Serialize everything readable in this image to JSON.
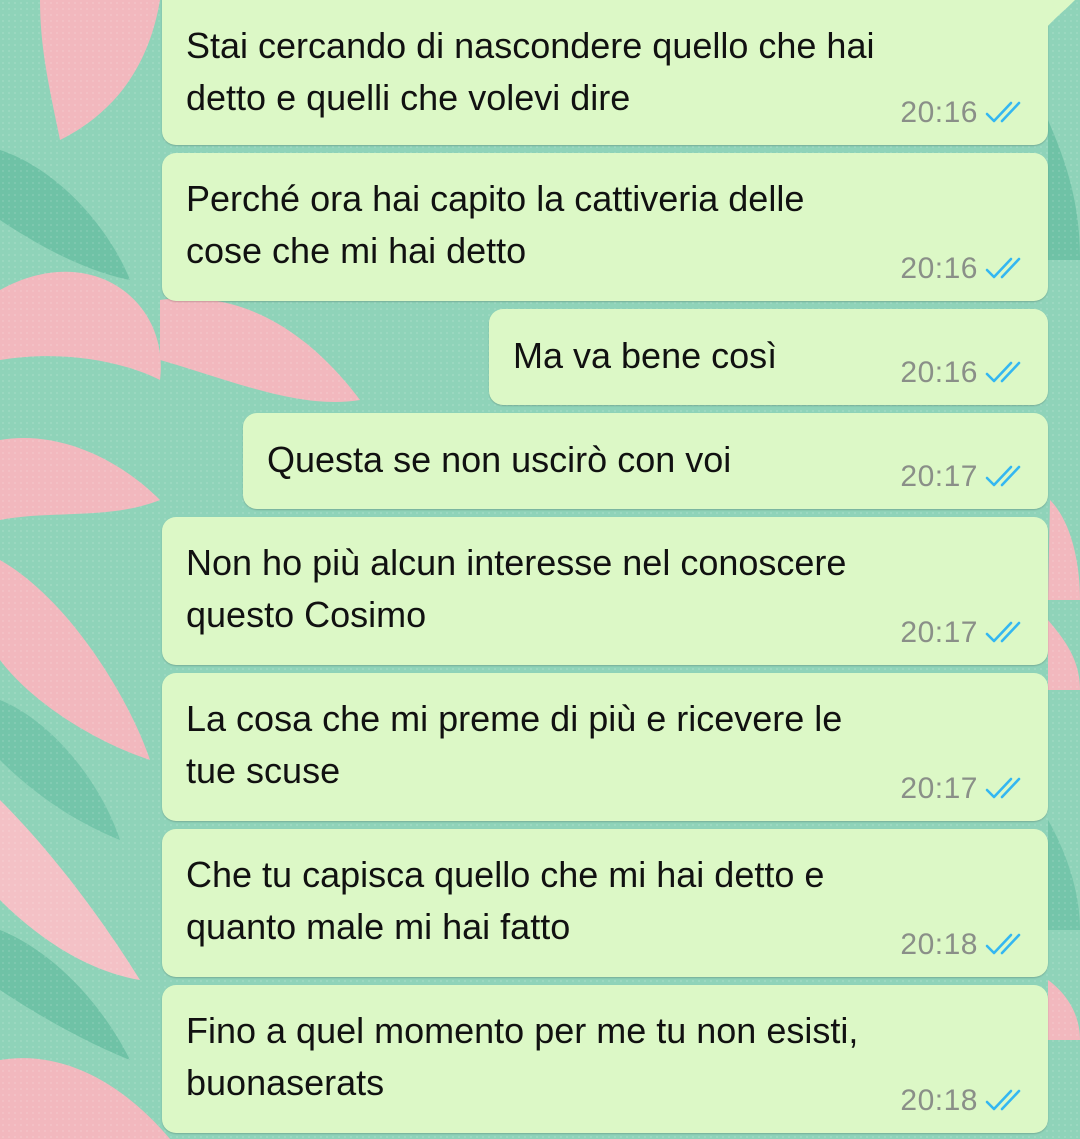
{
  "colors": {
    "bubble_outgoing": "#dcf8c6",
    "read_tick": "#34b7f1",
    "timestamp": "#8a8f88",
    "wallpaper_green": "#8fd3b9",
    "wallpaper_pink": "#f2b8be"
  },
  "messages": [
    {
      "text": "Stai cercando di nascondere quello che hai\ndetto e quelli che volevi dire",
      "time": "20:16",
      "status_icon": "double-check-read-icon"
    },
    {
      "text": "Perché ora hai capito la cattiveria delle\ncose che mi hai detto",
      "time": "20:16",
      "status_icon": "double-check-read-icon"
    },
    {
      "text": "Ma va bene così",
      "time": "20:16",
      "status_icon": "double-check-read-icon"
    },
    {
      "text": "Questa se non uscirò con voi",
      "time": "20:17",
      "status_icon": "double-check-read-icon"
    },
    {
      "text": "Non ho più alcun interesse nel conoscere\nquesto Cosimo",
      "time": "20:17",
      "status_icon": "double-check-read-icon"
    },
    {
      "text": "La cosa che mi preme di più e ricevere le\ntue scuse",
      "time": "20:17",
      "status_icon": "double-check-read-icon"
    },
    {
      "text": "Che tu capisca quello che mi hai detto e\nquanto male mi hai fatto",
      "time": "20:18",
      "status_icon": "double-check-read-icon"
    },
    {
      "text": "Fino a quel momento per me tu non esisti,\nbuonaserats",
      "time": "20:18",
      "status_icon": "double-check-read-icon"
    }
  ]
}
